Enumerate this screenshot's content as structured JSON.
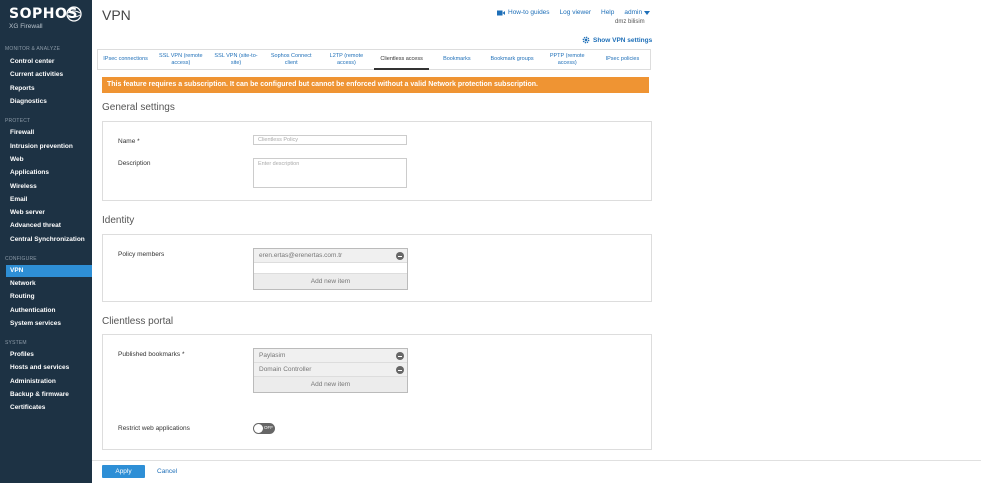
{
  "brand": {
    "name": "SOPHOS",
    "subtitle": "XG Firewall"
  },
  "sidebar": {
    "sections": [
      {
        "label": "MONITOR & ANALYZE",
        "items": [
          "Control center",
          "Current activities",
          "Reports",
          "Diagnostics"
        ]
      },
      {
        "label": "PROTECT",
        "items": [
          "Firewall",
          "Intrusion prevention",
          "Web",
          "Applications",
          "Wireless",
          "Email",
          "Web server",
          "Advanced threat",
          "Central Synchronization"
        ]
      },
      {
        "label": "CONFIGURE",
        "items": [
          "VPN",
          "Network",
          "Routing",
          "Authentication",
          "System services"
        ]
      },
      {
        "label": "SYSTEM",
        "items": [
          "Profiles",
          "Hosts and services",
          "Administration",
          "Backup & firmware",
          "Certificates"
        ]
      }
    ],
    "active": "VPN"
  },
  "header": {
    "title": "VPN",
    "how_to": "How-to guides",
    "log_viewer": "Log viewer",
    "help": "Help",
    "admin": "admin",
    "device": "dmz bilisim",
    "show_settings": "Show VPN settings"
  },
  "tabs": [
    "IPsec connections",
    "SSL VPN (remote access)",
    "SSL VPN (site-to-site)",
    "Sophos Connect client",
    "L2TP (remote access)",
    "Clientless access",
    "Bookmarks",
    "Bookmark groups",
    "PPTP (remote access)",
    "IPsec policies"
  ],
  "active_tab": "Clientless access",
  "warning": "This feature requires a subscription. It can be configured but cannot be enforced without a valid Network protection subscription.",
  "general": {
    "title": "General settings",
    "name_label": "Name *",
    "name_placeholder": "Clientless Policy",
    "desc_label": "Description",
    "desc_placeholder": "Enter description"
  },
  "identity": {
    "title": "Identity",
    "members_label": "Policy members",
    "members": [
      "eren.ertas@erenertas.com.tr"
    ],
    "add_new": "Add new item"
  },
  "portal": {
    "title": "Clientless portal",
    "bookmarks_label": "Published bookmarks *",
    "bookmarks": [
      "Paylasim",
      "Domain Controller"
    ],
    "add_new": "Add new item",
    "restrict_label": "Restrict web applications",
    "toggle_state": "OFF"
  },
  "footer": {
    "apply": "Apply",
    "cancel": "Cancel"
  },
  "colors": {
    "sidebar": "#1d3244",
    "accent": "#2e8fd6",
    "warning": "#ef9433"
  }
}
